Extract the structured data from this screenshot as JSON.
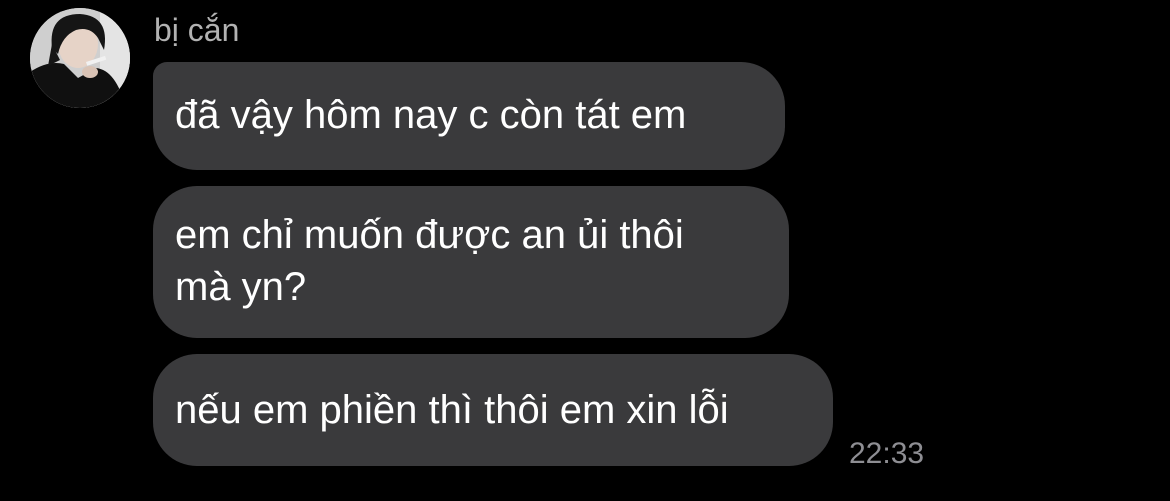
{
  "conversation": {
    "sender": {
      "name": "bị cắn",
      "avatar_icon": "profile-photo"
    },
    "messages": [
      {
        "text": "đã vậy hôm nay c còn tát em"
      },
      {
        "text": "em chỉ muốn được an ủi thôi\nmà yn?"
      },
      {
        "text": "nếu em phiền thì thôi em xin lỗi"
      }
    ],
    "timestamp": "22:33"
  },
  "colors": {
    "background": "#000000",
    "bubble": "#3a3a3c",
    "message_text": "#ffffff",
    "sender_name": "#b2b2b2",
    "timestamp": "#8e8e93"
  }
}
